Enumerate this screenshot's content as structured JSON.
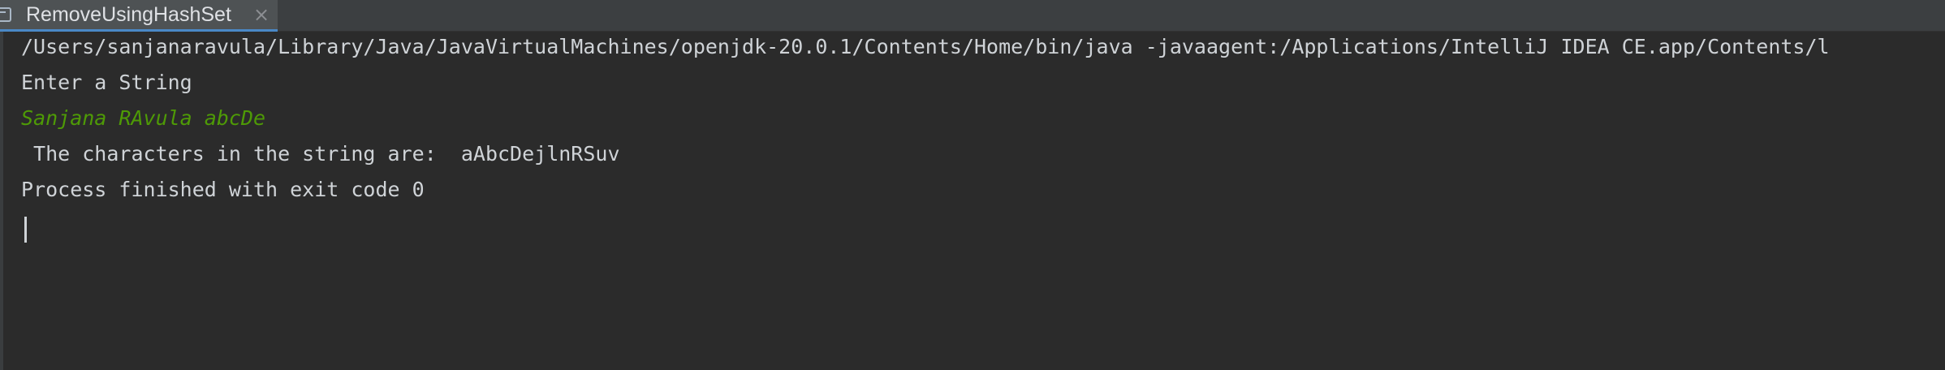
{
  "tab": {
    "title": "RemoveUsingHashSet",
    "close_glyph": "×",
    "icon": "run-console-icon"
  },
  "console": {
    "lines": [
      "/Users/sanjanaravula/Library/Java/JavaVirtualMachines/openjdk-20.0.1/Contents/Home/bin/java -javaagent:/Applications/IntelliJ IDEA CE.app/Contents/l",
      "Enter a String",
      "Sanjana RAvula abcDe",
      " The characters in the string are:  aAbcDejlnRSuv",
      "Process finished with exit code 0"
    ],
    "colors": {
      "output": "#cfd3d7",
      "user_input": "#4e9a06",
      "background": "#2b2b2b"
    }
  }
}
